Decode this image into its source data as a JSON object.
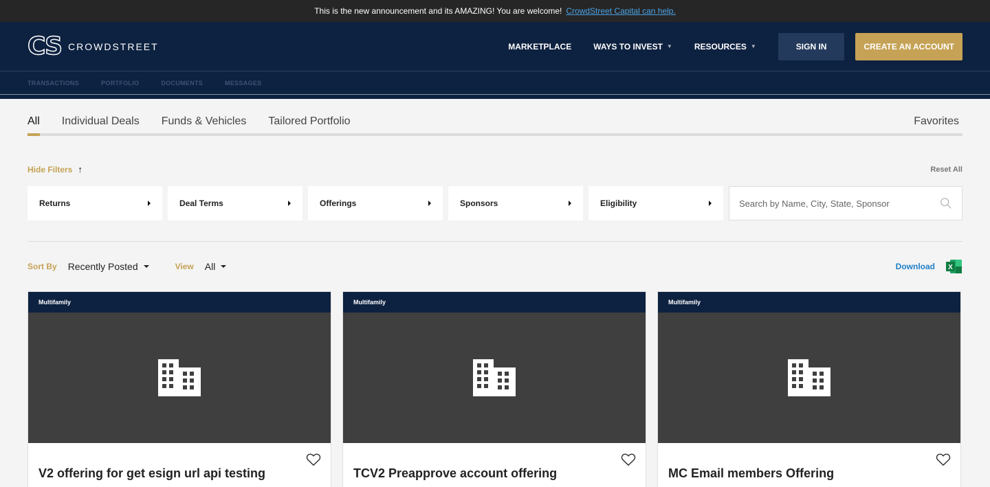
{
  "announcement": {
    "text": "This is the new announcement and its AMAZING! You are welcome!",
    "link": "CrowdStreet Capital can help."
  },
  "header": {
    "logo_mark": "CS",
    "logo_text": "CROWDSTREET",
    "nav": [
      {
        "label": "MARKETPLACE"
      },
      {
        "label": "WAYS TO INVEST"
      },
      {
        "label": "RESOURCES"
      }
    ],
    "signin_label": "SIGN IN",
    "create_label": "CREATE AN ACCOUNT"
  },
  "subnav": [
    "TRANSACTIONS",
    "PORTFOLIO",
    "DOCUMENTS",
    "MESSAGES"
  ],
  "tabs": {
    "items": [
      "All",
      "Individual Deals",
      "Funds & Vehicles",
      "Tailored Portfolio"
    ],
    "active": "All",
    "favorites": "Favorites"
  },
  "filters": {
    "hide_label": "Hide Filters",
    "reset_label": "Reset All",
    "items": [
      "Returns",
      "Deal Terms",
      "Offerings",
      "Sponsors",
      "Eligibility"
    ],
    "search_placeholder": "Search by Name, City, State, Sponsor"
  },
  "sort": {
    "sort_label": "Sort By",
    "sort_value": "Recently Posted",
    "view_label": "View",
    "view_value": "All",
    "download_label": "Download",
    "excel_letter": "X"
  },
  "cards": [
    {
      "category": "Multifamily",
      "title": "V2 offering for get esign url api testing"
    },
    {
      "category": "Multifamily",
      "title": "TCV2 Preapprove account offering"
    },
    {
      "category": "Multifamily",
      "title": "MC Email members Offering"
    }
  ],
  "colors": {
    "navy": "#0d2140",
    "gold": "#c5a255",
    "link_blue": "#1f7fc7"
  }
}
